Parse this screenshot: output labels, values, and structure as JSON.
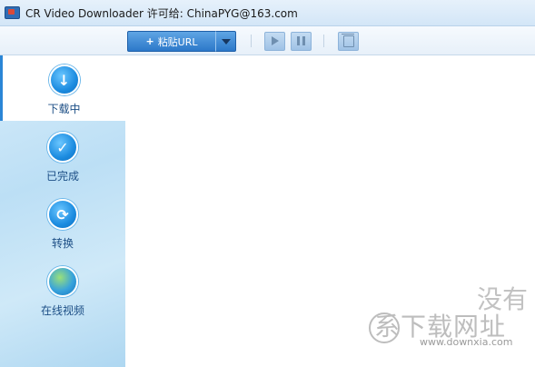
{
  "window": {
    "title": "CR Video Downloader  许可给: ChinaPYG@163.com"
  },
  "toolbar": {
    "paste_label": "粘贴URL",
    "paste_plus": "+",
    "buttons": [
      "play",
      "pause",
      "delete"
    ]
  },
  "sidebar": {
    "items": [
      {
        "label": "下载中",
        "icon": "download-icon",
        "active": true
      },
      {
        "label": "已完成",
        "icon": "check-icon",
        "active": false
      },
      {
        "label": "转换",
        "icon": "convert-icon",
        "active": false
      },
      {
        "label": "在线视频",
        "icon": "globe-icon",
        "active": false
      }
    ]
  },
  "watermark": {
    "line1": "没有",
    "line2": "系下载网址",
    "url": "www.downxia.com"
  },
  "colors": {
    "accent": "#2c78c9",
    "sidebar_text": "#1d4f86"
  }
}
